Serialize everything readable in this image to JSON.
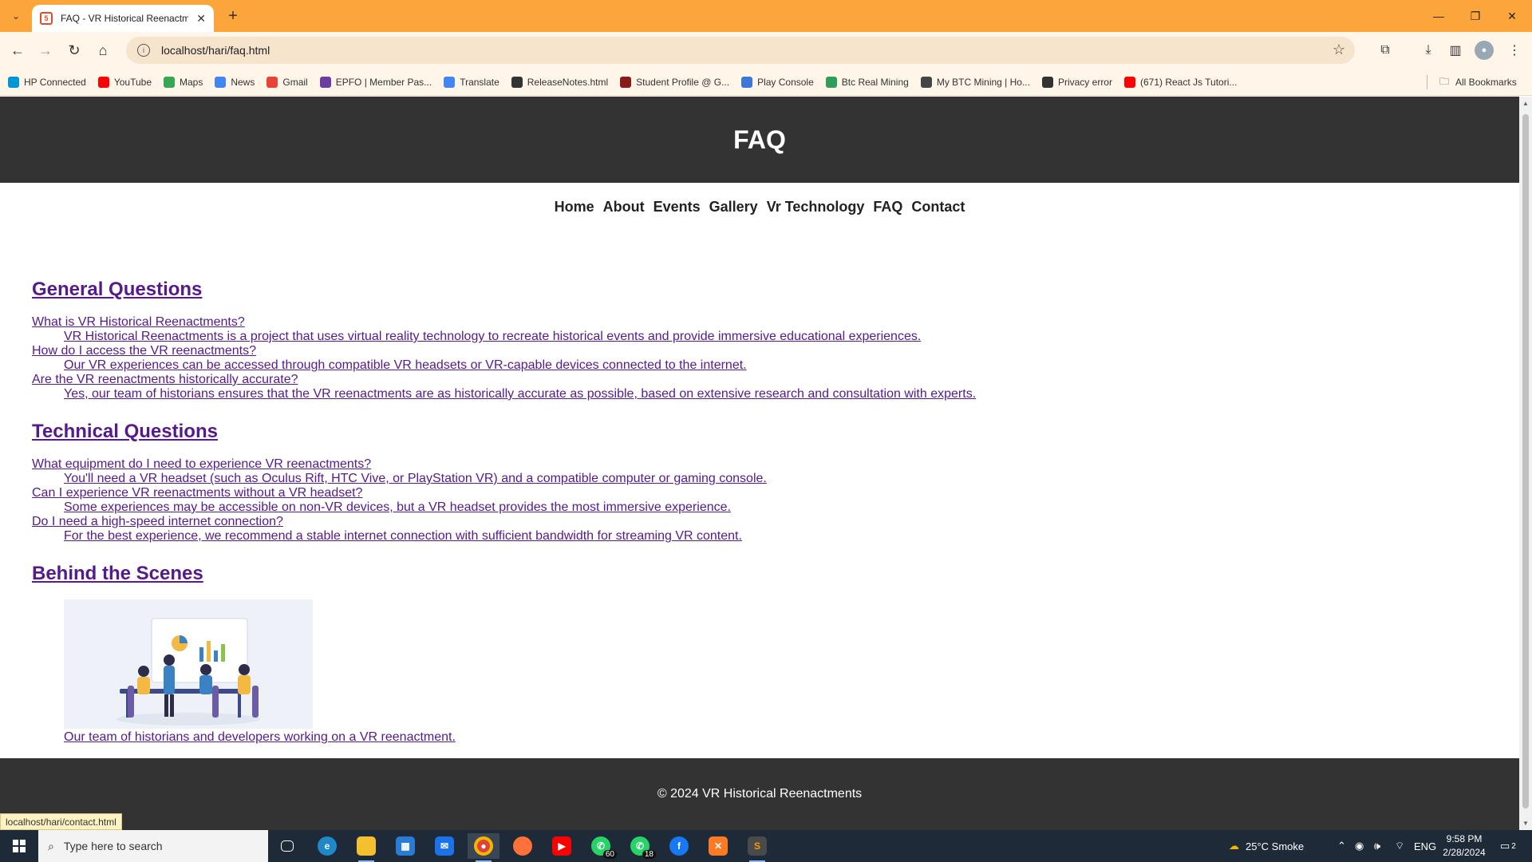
{
  "browser": {
    "tab_title": "FAQ - VR Historical Reenactments",
    "url": "localhost/hari/faq.html",
    "bookmarks": [
      {
        "label": "HP Connected",
        "icon": "hp-icon",
        "color": "#0096d6"
      },
      {
        "label": "YouTube",
        "icon": "youtube-icon",
        "color": "#ff0000"
      },
      {
        "label": "Maps",
        "icon": "maps-icon",
        "color": "#34a853"
      },
      {
        "label": "News",
        "icon": "news-icon",
        "color": "#4285f4"
      },
      {
        "label": "Gmail",
        "icon": "gmail-icon",
        "color": "#ea4335"
      },
      {
        "label": "EPFO | Member Pas...",
        "icon": "epfo-icon",
        "color": "#6b3fa0"
      },
      {
        "label": "Translate",
        "icon": "translate-icon",
        "color": "#4285f4"
      },
      {
        "label": "ReleaseNotes.html",
        "icon": "globe-icon",
        "color": "#333333"
      },
      {
        "label": "Student Profile @ G...",
        "icon": "student-icon",
        "color": "#8b1a1a"
      },
      {
        "label": "Play Console",
        "icon": "play-console-icon",
        "color": "#3c78d8"
      },
      {
        "label": "Btc Real Mining",
        "icon": "btc-icon",
        "color": "#2e9e5b"
      },
      {
        "label": "My BTC Mining | Ho...",
        "icon": "mining-icon",
        "color": "#444444"
      },
      {
        "label": "Privacy error",
        "icon": "globe-icon",
        "color": "#333333"
      },
      {
        "label": "(671) React Js Tutori...",
        "icon": "youtube-icon",
        "color": "#ff0000"
      }
    ],
    "all_bookmarks": "All Bookmarks",
    "status_url": "localhost/hari/contact.html"
  },
  "page": {
    "title": "FAQ",
    "nav": [
      "Home",
      "About",
      "Events",
      "Gallery",
      "Vr Technology",
      "FAQ",
      "Contact"
    ],
    "sections": [
      {
        "heading": "General Questions",
        "items": [
          {
            "q": "What is VR Historical Reenactments?",
            "a": "VR Historical Reenactments is a project that uses virtual reality technology to recreate historical events and provide immersive educational experiences."
          },
          {
            "q": "How do I access the VR reenactments?",
            "a": "Our VR experiences can be accessed through compatible VR headsets or VR-capable devices connected to the internet."
          },
          {
            "q": "Are the VR reenactments historically accurate?",
            "a": "Yes, our team of historians ensures that the VR reenactments are as historically accurate as possible, based on extensive research and consultation with experts."
          }
        ]
      },
      {
        "heading": "Technical Questions",
        "items": [
          {
            "q": "What equipment do I need to experience VR reenactments?",
            "a": "You'll need a VR headset (such as Oculus Rift, HTC Vive, or PlayStation VR) and a compatible computer or gaming console."
          },
          {
            "q": "Can I experience VR reenactments without a VR headset?",
            "a": "Some experiences may be accessible on non-VR devices, but a VR headset provides the most immersive experience."
          },
          {
            "q": "Do I need a high-speed internet connection?",
            "a": "For the best experience, we recommend a stable internet connection with sufficient bandwidth for streaming VR content."
          }
        ]
      }
    ],
    "behind": {
      "heading": "Behind the Scenes",
      "caption": "Our team of historians and developers working on a VR reenactment."
    },
    "footer": "© 2024 VR Historical Reenactments"
  },
  "taskbar": {
    "search_placeholder": "Type here to search",
    "whatsapp_badge": "60",
    "whatsapp_business_badge": "18",
    "weather": "25°C  Smoke",
    "language": "ENG",
    "time": "9:58 PM",
    "date": "2/28/2024",
    "notifications": "2"
  }
}
